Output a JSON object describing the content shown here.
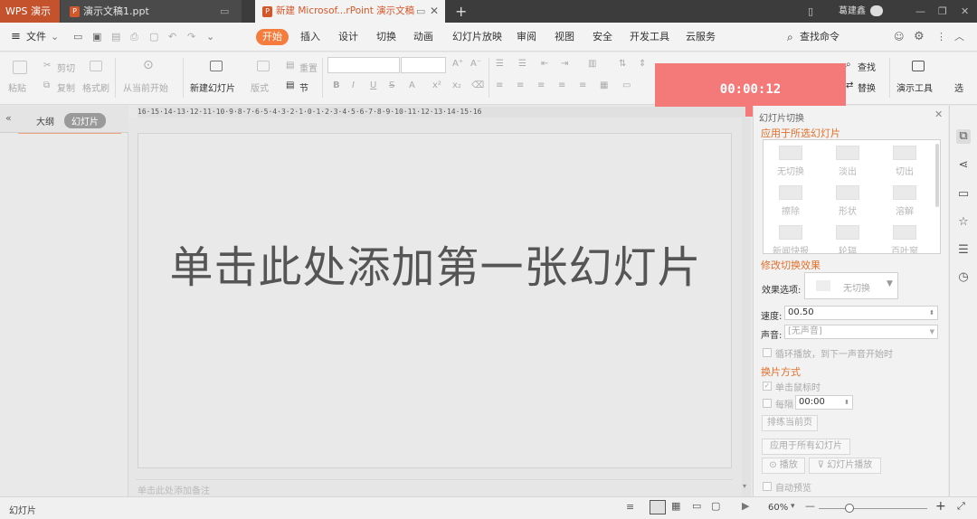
{
  "titlebar": {
    "app_label": "WPS 演示",
    "tab1_label": "演示文稿1.ppt",
    "tab2_label": "新建 Microsof...rPoint 演示文稿",
    "new_tab": "+",
    "user_name": "葛建鑫"
  },
  "menu": {
    "file": "文件",
    "tabs": [
      "开始",
      "插入",
      "设计",
      "切换",
      "动画",
      "幻灯片放映",
      "审阅",
      "视图",
      "安全",
      "开发工具",
      "云服务"
    ],
    "search": "查找命令"
  },
  "toolbar": {
    "paste": "粘贴",
    "cut": "剪切",
    "copy": "复制",
    "format_painter": "格式刷",
    "from_current": "从当前开始",
    "new_slide": "新建幻灯片",
    "layout": "版式",
    "reset": "重置",
    "section": "节",
    "find": "查找",
    "replace": "替换",
    "presentation_tools": "演示工具",
    "select": "选"
  },
  "timer": "00:00:12",
  "left_panel": {
    "collapse": "«",
    "tab_outline": "大纲",
    "tab_slides": "幻灯片"
  },
  "ruler_text": "16·15·14·13·12·11·10·9·8·7·6·5·4·3·2·1·0·1·2·3·4·5·6·7·8·9·10·11·12·13·14·15·16",
  "slide": {
    "title_placeholder": "单击此处添加第一张幻灯片"
  },
  "notes_placeholder": "单击此处添加备注",
  "right_panel": {
    "title": "幻灯片切换",
    "apply_selected": "应用于所选幻灯片",
    "transitions": [
      "无切换",
      "淡出",
      "切出",
      "擦除",
      "形状",
      "溶解",
      "新闻快报",
      "轮辐",
      "百叶窗"
    ],
    "modify_effect": "修改切换效果",
    "effect_options_label": "效果选项:",
    "effect_options_value": "无切换",
    "speed_label": "速度:",
    "speed_value": "00.50",
    "sound_label": "声音:",
    "sound_value": "[无声音]",
    "loop_label": "循环播放，到下一声音开始时",
    "advance_heading": "换片方式",
    "on_click_label": "单击鼠标时",
    "every_label": "每隔",
    "every_value": "00:00",
    "rehearse": "排练当前页",
    "apply_all": "应用于所有幻灯片",
    "play": "播放",
    "slideshow": "幻灯片播放",
    "auto_preview": "自动预览"
  },
  "status": {
    "left": "幻灯片",
    "zoom": "60%"
  }
}
